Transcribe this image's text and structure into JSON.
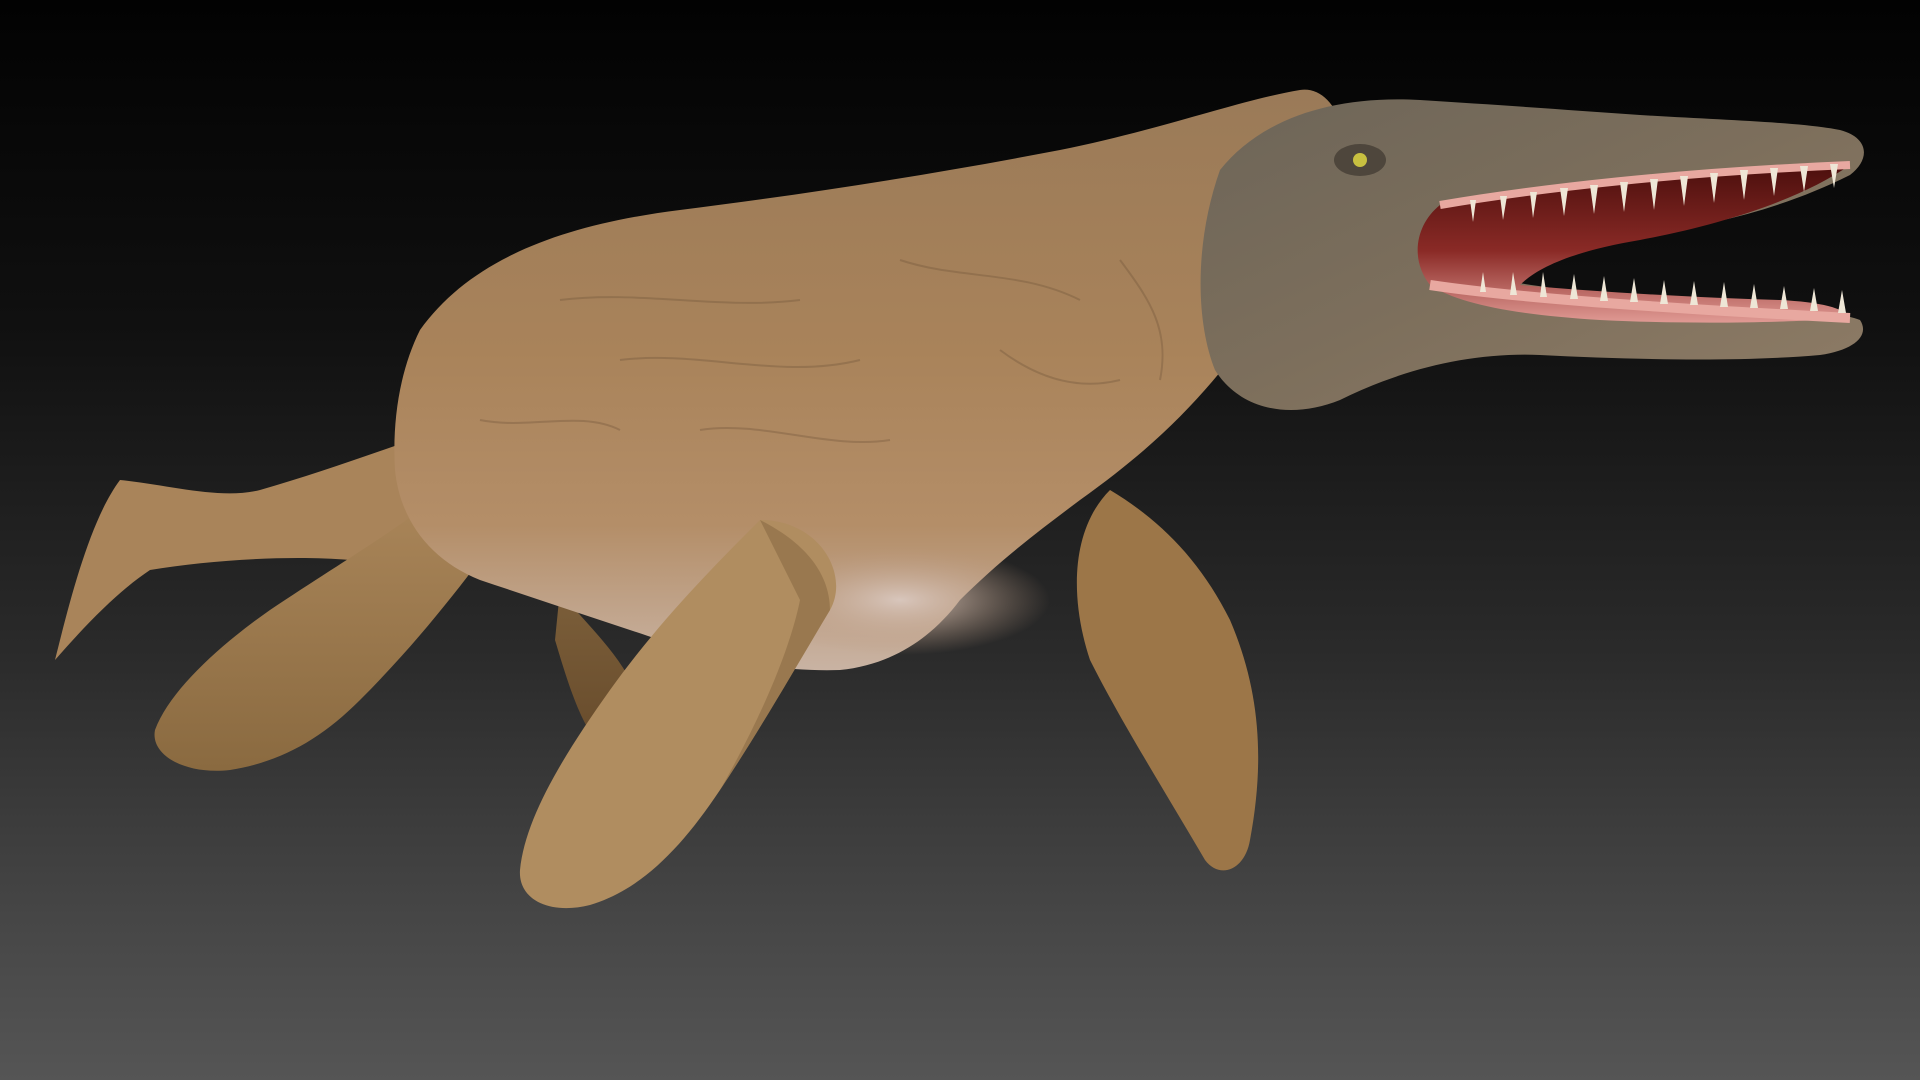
{
  "scene": {
    "subject_icon": "marine-reptile-icon",
    "colors": {
      "background_top": "#020202",
      "background_bottom": "#555555",
      "skin_light": "#b08a5e",
      "skin_mid": "#8e6b47",
      "skin_dark": "#5e4a35",
      "head_gray": "#6a6256",
      "mouth_pink": "#d98a86",
      "mouth_dark": "#5a1a18",
      "tooth": "#eee6d6",
      "eye": "#c8c040"
    }
  }
}
